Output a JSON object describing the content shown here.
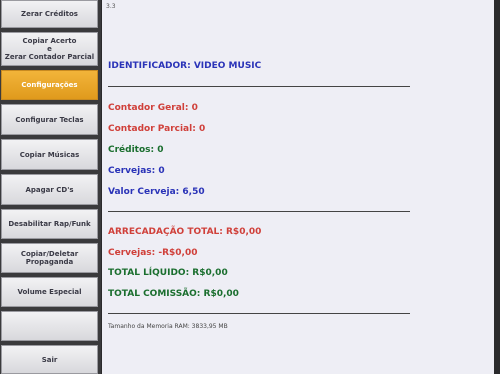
{
  "sidebar": {
    "items": [
      {
        "label": "Zerar Créditos"
      },
      {
        "label": "Copiar Acerto\ne\nZerar Contador Parcial"
      },
      {
        "label": "Configurações"
      },
      {
        "label": "Configurar Teclas"
      },
      {
        "label": "Copiar Músicas"
      },
      {
        "label": "Apagar CD's"
      },
      {
        "label": "Desabilitar Rap/Funk"
      },
      {
        "label": "Copiar/Deletar\nPropaganda"
      },
      {
        "label": "Volume Especial"
      },
      {
        "label": "Sair"
      }
    ]
  },
  "main": {
    "version": "3.3",
    "identificador": "IDENTIFICADOR: VIDEO MUSIC",
    "contador_geral": "Contador Geral: 0",
    "contador_parcial": "Contador Parcial: 0",
    "creditos": "Créditos: 0",
    "cervejas": "Cervejas: 0",
    "valor_cerveja": "Valor Cerveja: 6,50",
    "arrecadacao_total": "ARRECADAÇÃO TOTAL: R$0,00",
    "cervejas_desconto": "Cervejas: -R$0,00",
    "total_liquido": "TOTAL LÍQUIDO: R$0,00",
    "total_comissao": "TOTAL COMISSÃO: R$0,00",
    "memoria": "Tamanho da Memoria RAM: 3833,95 MB"
  },
  "colors": {
    "accent_orange": "#e8a328",
    "text_blue": "#2a33b8",
    "text_red": "#d0403a",
    "text_green": "#1a6e2e"
  }
}
